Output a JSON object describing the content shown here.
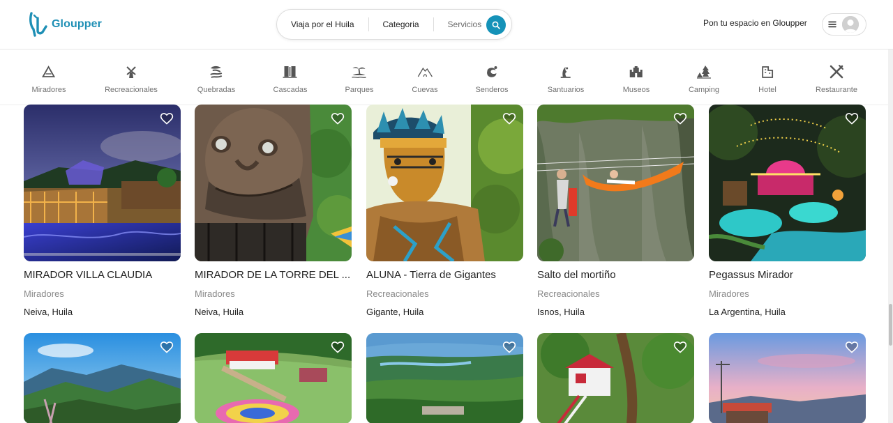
{
  "brand": {
    "name": "Gloupper",
    "color": "#1e8fb5"
  },
  "search": {
    "where_label": "Viaja por el Huila",
    "category_label": "Categoria",
    "services_label": "Servicios",
    "button_color": "#1592b8"
  },
  "header": {
    "host_link": "Pon tu espacio en Gloupper"
  },
  "categories": [
    {
      "label": "Miradores",
      "icon": "mountain-triangle-icon"
    },
    {
      "label": "Recreacionales",
      "icon": "windmill-icon"
    },
    {
      "label": "Quebradas",
      "icon": "stream-icon"
    },
    {
      "label": "Cascadas",
      "icon": "waterfall-icon"
    },
    {
      "label": "Parques",
      "icon": "palm-island-icon"
    },
    {
      "label": "Cuevas",
      "icon": "cave-icon"
    },
    {
      "label": "Senderos",
      "icon": "trail-wave-icon"
    },
    {
      "label": "Santuarios",
      "icon": "sanctuary-icon"
    },
    {
      "label": "Museos",
      "icon": "castle-icon"
    },
    {
      "label": "Camping",
      "icon": "tent-tree-icon"
    },
    {
      "label": "Hotel",
      "icon": "hotel-icon"
    },
    {
      "label": "Restaurante",
      "icon": "utensils-icon"
    }
  ],
  "listings": [
    {
      "title": "MIRADOR VILLA CLAUDIA",
      "category": "Miradores",
      "location": "Neiva, Huila"
    },
    {
      "title": "MIRADOR DE LA TORRE DEL ...",
      "category": "Miradores",
      "location": "Neiva, Huila"
    },
    {
      "title": "ALUNA - Tierra de Gigantes",
      "category": "Recreacionales",
      "location": "Gigante, Huila"
    },
    {
      "title": "Salto del mortiño",
      "category": "Recreacionales",
      "location": "Isnos, Huila"
    },
    {
      "title": "Pegassus Mirador",
      "category": "Miradores",
      "location": "La Argentina, Huila"
    }
  ]
}
